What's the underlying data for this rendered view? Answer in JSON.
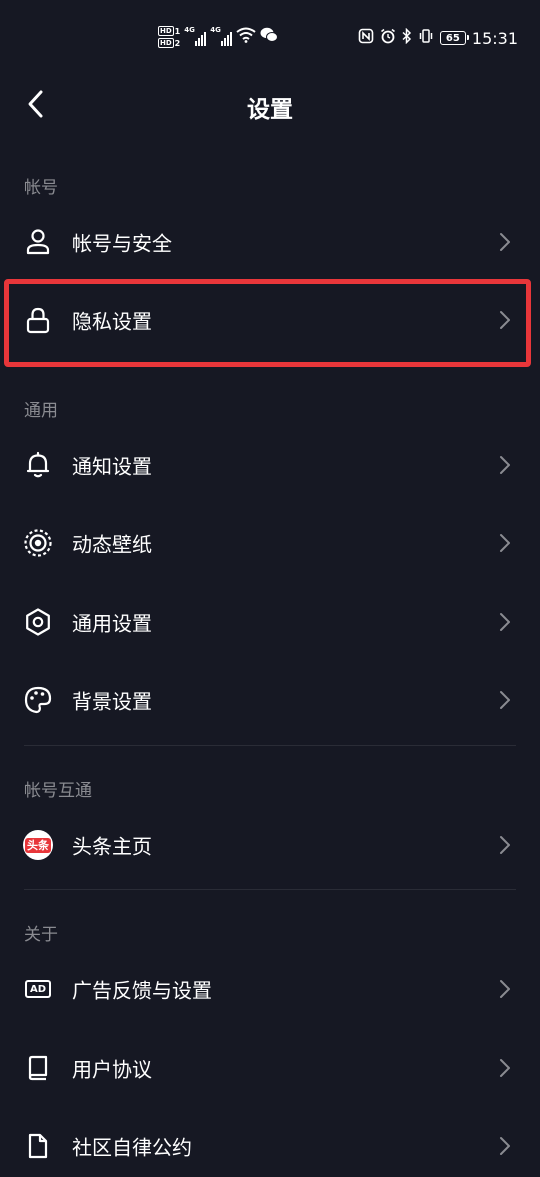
{
  "status_bar": {
    "hd1": "HD",
    "hd1_num": "1",
    "hd2": "HD",
    "hd2_num": "2",
    "net1": "4G",
    "net2": "4G",
    "battery": "65",
    "time": "15:31"
  },
  "header": {
    "title": "设置"
  },
  "sections": {
    "account": {
      "label": "帐号",
      "items": [
        {
          "label": "帐号与安全",
          "icon": "user-icon"
        },
        {
          "label": "隐私设置",
          "icon": "lock-icon"
        }
      ]
    },
    "general": {
      "label": "通用",
      "items": [
        {
          "label": "通知设置",
          "icon": "bell-icon"
        },
        {
          "label": "动态壁纸",
          "icon": "live-wallpaper-icon"
        },
        {
          "label": "通用设置",
          "icon": "gear-icon"
        },
        {
          "label": "背景设置",
          "icon": "palette-icon"
        }
      ]
    },
    "linked": {
      "label": "帐号互通",
      "items": [
        {
          "label": "头条主页",
          "icon": "toutiao-icon",
          "badge": "头条"
        }
      ]
    },
    "about": {
      "label": "关于",
      "items": [
        {
          "label": "广告反馈与设置",
          "icon": "ad-icon",
          "badge": "AD"
        },
        {
          "label": "用户协议",
          "icon": "book-icon"
        },
        {
          "label": "社区自律公约",
          "icon": "document-icon"
        }
      ]
    }
  },
  "colors": {
    "background": "#161823",
    "highlight": "#e8363a",
    "section_label": "#8a8b91"
  }
}
